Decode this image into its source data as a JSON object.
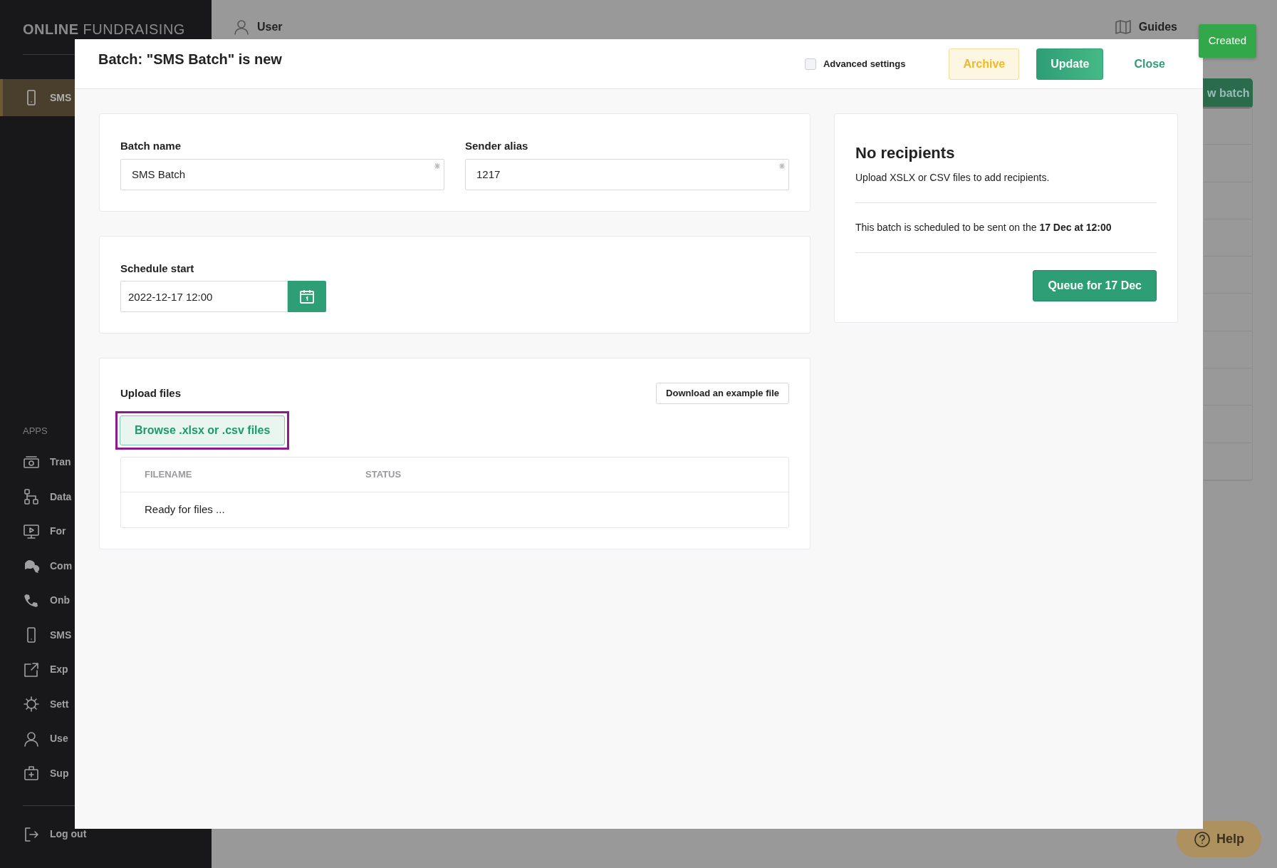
{
  "sidebar": {
    "logo_bold": "ONLINE",
    "logo_light": "FUNDRAISING",
    "active_item": {
      "label": "SMS",
      "selected": true
    },
    "apps_heading": "APPS",
    "items": [
      {
        "label": "Tran",
        "selected": false
      },
      {
        "label": "Data",
        "selected": false
      },
      {
        "label": "For",
        "selected": false
      },
      {
        "label": "Com",
        "selected": false
      },
      {
        "label": "Onb",
        "selected": false
      },
      {
        "label": "SMS",
        "selected": false
      },
      {
        "label": "Exp",
        "selected": false
      },
      {
        "label": "Sett",
        "selected": false
      },
      {
        "label": "Use",
        "selected": false
      },
      {
        "label": "Sup",
        "selected": false
      }
    ],
    "logout": {
      "label": "Log out"
    }
  },
  "topbar": {
    "user": "User",
    "guides": "Guides"
  },
  "toast": "Created",
  "new_batch_button": "w batch",
  "modal": {
    "title": "Batch: \"SMS Batch\" is new",
    "advanced_settings": {
      "label": "Advanced settings",
      "checked": false
    },
    "buttons": [
      {
        "kind": "archive",
        "label": "Archive"
      },
      {
        "kind": "update",
        "label": "Update"
      },
      {
        "kind": "close",
        "label": "Close"
      }
    ],
    "fields": [
      {
        "label": "Batch name",
        "value": "SMS Batch",
        "required": true
      },
      {
        "label": "Sender alias",
        "value": "1217",
        "required": true
      }
    ],
    "schedule": {
      "label": "Schedule start",
      "value": "2022-12-17 12:00"
    },
    "upload": {
      "label": "Upload files",
      "example_button": "Download an example file",
      "browse_button": "Browse .xlsx or .csv files",
      "browse_focused": true,
      "columns": [
        "FILENAME",
        "STATUS"
      ],
      "empty_text": "Ready for files ..."
    },
    "recipients": {
      "title": "No recipients",
      "hint": "Upload XSLX or CSV files to add recipients.",
      "schedule_text": "This batch is scheduled to be sent on the **17 Dec at 12:00**",
      "queue_button": "Queue for 17 Dec"
    }
  },
  "help": "Help"
}
